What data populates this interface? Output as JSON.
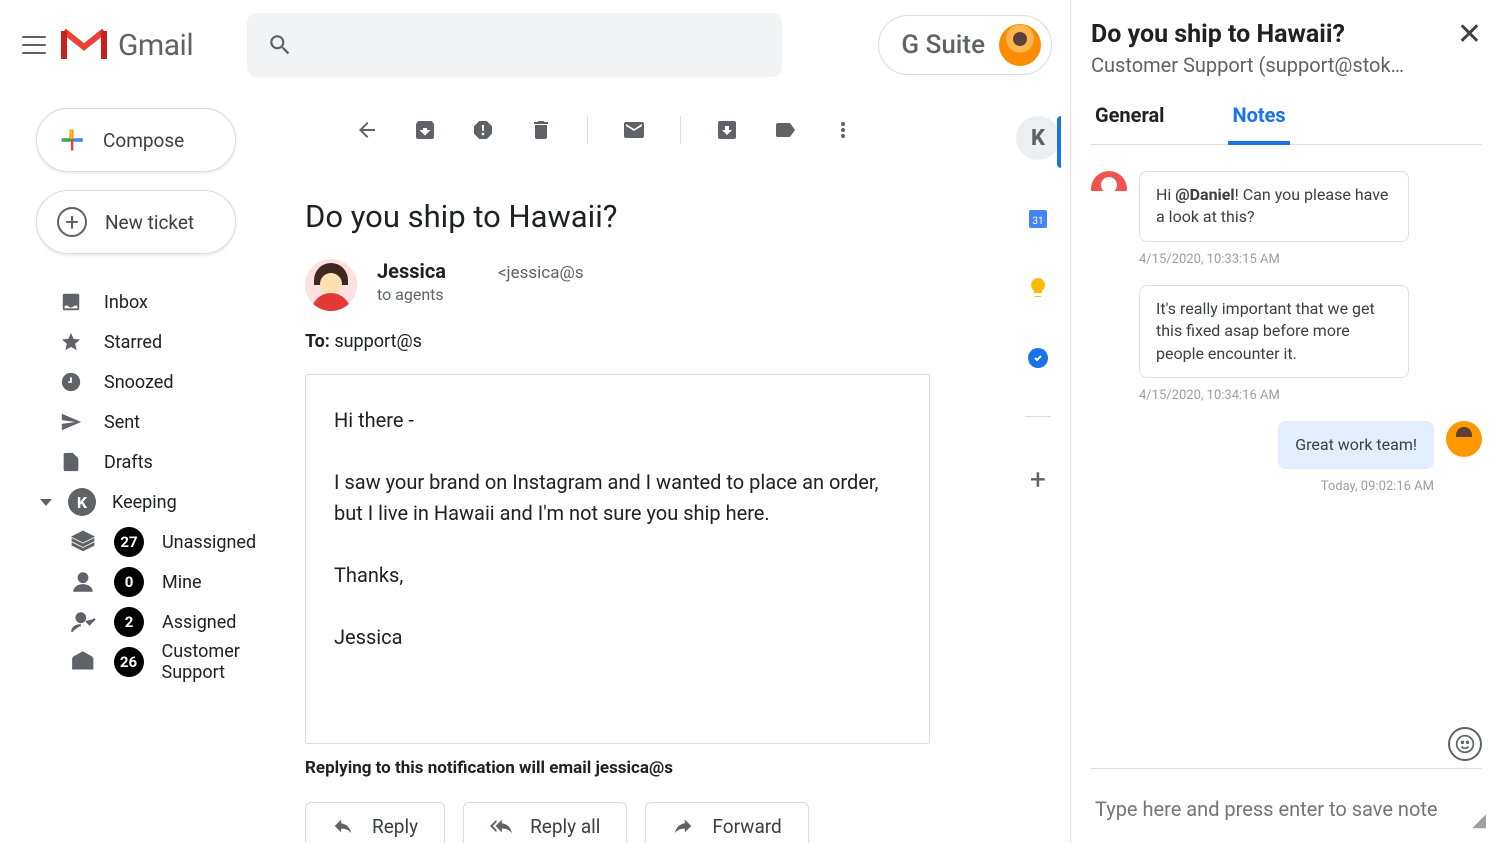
{
  "header": {
    "product": "Gmail",
    "suite": "G Suite"
  },
  "sidebar": {
    "compose": "Compose",
    "new_ticket": "New ticket",
    "items": [
      {
        "label": "Inbox"
      },
      {
        "label": "Starred"
      },
      {
        "label": "Snoozed"
      },
      {
        "label": "Sent"
      },
      {
        "label": "Drafts"
      }
    ],
    "keeping_label": "Keeping",
    "keeping_items": [
      {
        "label": "Unassigned",
        "count": "27"
      },
      {
        "label": "Mine",
        "count": "0"
      },
      {
        "label": "Assigned",
        "count": "2"
      },
      {
        "label": "Customer Support",
        "count": "26"
      }
    ]
  },
  "message": {
    "subject": "Do you ship to Hawaii?",
    "sender_name": "Jessica",
    "sender_addr": "<jessica@s",
    "to_agents": "to agents",
    "to_line_label": "To: ",
    "to_line_value": "support@s",
    "body_greeting": "Hi there -",
    "body_para": "I saw your brand on Instagram and I wanted to place an order, but I live in Hawaii and I'm not sure you ship here.",
    "body_thanks": "Thanks,",
    "body_sign": "Jessica",
    "reply_note": "Replying to this notification will email jessica@s",
    "actions": {
      "reply": "Reply",
      "reply_all": "Reply all",
      "forward": "Forward"
    }
  },
  "panel": {
    "title": "Do you ship to Hawaii?",
    "subtitle": "Customer Support (support@stok…",
    "tabs": {
      "general": "General",
      "notes": "Notes"
    },
    "notes": [
      {
        "side": "left",
        "text_pre": "Hi ",
        "mention": "@Daniel",
        "text_post": "! Can you please have a look at this?",
        "ts": "4/15/2020, 10:33:15 AM"
      },
      {
        "side": "left",
        "text": "It's really important that we get this fixed asap before more people encounter it.",
        "ts": "4/15/2020, 10:34:16 AM"
      },
      {
        "side": "right",
        "text": "Great work team!",
        "ts": "Today, 09:02:16 AM"
      }
    ],
    "input_placeholder": "Type here and press enter to save note"
  },
  "colors": {
    "accent": "#1a73e8"
  }
}
